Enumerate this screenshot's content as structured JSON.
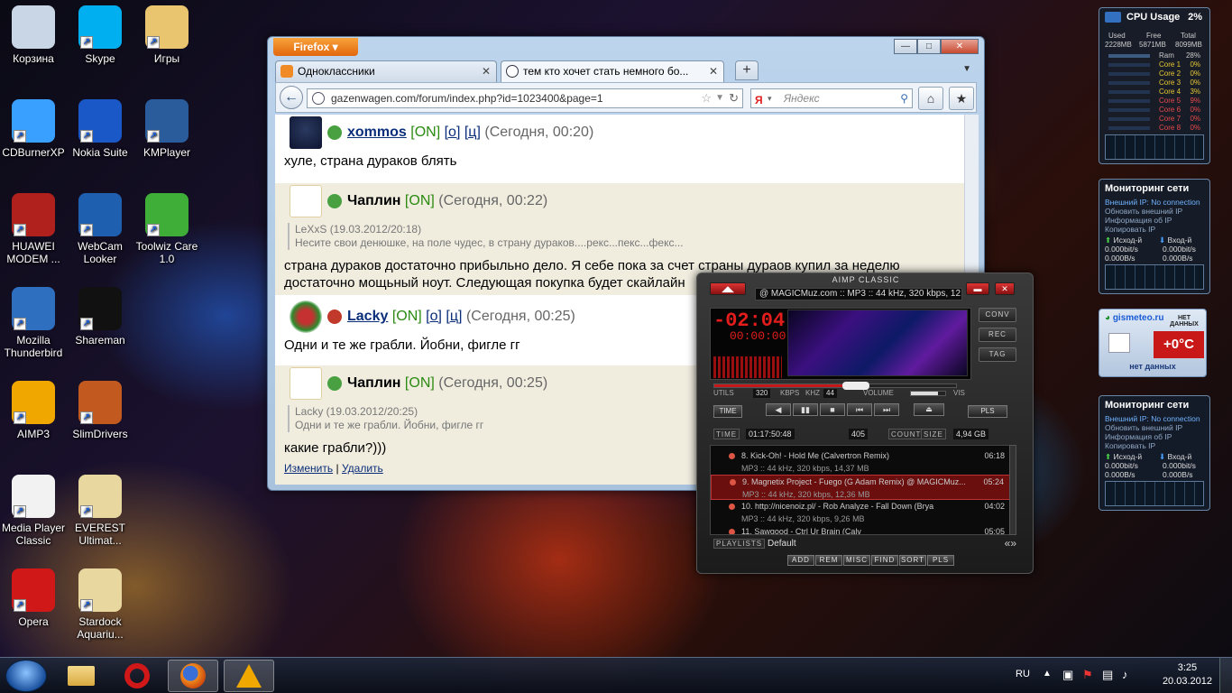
{
  "desktop": {
    "icons": [
      {
        "label": "Корзина",
        "icon": "recycle-bin-icon",
        "color": "#c9d6e6"
      },
      {
        "label": "Skype",
        "icon": "skype-icon",
        "color": "#00aff0"
      },
      {
        "label": "Игры",
        "icon": "folder-icon",
        "color": "#e8c56e"
      },
      {
        "label": "CDBurnerXP",
        "icon": "cd-icon",
        "color": "#3aa0ff"
      },
      {
        "label": "Nokia Suite",
        "icon": "nokia-suite-icon",
        "color": "#1a58c8"
      },
      {
        "label": "KMPlayer",
        "icon": "kmplayer-icon",
        "color": "#2a5c9c"
      },
      {
        "label": "HUAWEI MODEM ...",
        "icon": "helmet-icon",
        "color": "#b0201c"
      },
      {
        "label": "WebCam Looker",
        "icon": "webcam-icon",
        "color": "#1f5fb0"
      },
      {
        "label": "Toolwiz Care 1.0",
        "icon": "shield-icon",
        "color": "#3fae38"
      },
      {
        "label": "Mozilla Thunderbird",
        "icon": "thunderbird-icon",
        "color": "#2e6fc0"
      },
      {
        "label": "Shareman",
        "icon": "shareman-icon",
        "color": "#111111"
      },
      {
        "label": "AIMP3",
        "icon": "aimp-icon",
        "color": "#f0a800"
      },
      {
        "label": "SlimDrivers",
        "icon": "slimdrivers-icon",
        "color": "#c25a20"
      },
      {
        "label": "Media Player Classic",
        "icon": "clapperboard-icon",
        "color": "#f2f2f2"
      },
      {
        "label": "EVEREST Ultimat...",
        "icon": "folder-icon",
        "color": "#e8d8a0"
      },
      {
        "label": "Opera",
        "icon": "opera-icon",
        "color": "#d01818"
      },
      {
        "label": "Stardock Aquariu...",
        "icon": "folder-icon",
        "color": "#e8d8a0"
      }
    ]
  },
  "firefox": {
    "menu_label": "Firefox",
    "tabs": [
      {
        "label": "Одноклассники",
        "color": "#f08a24"
      },
      {
        "label": "тем кто хочет стать немного бо...",
        "color": "#ffffff"
      }
    ],
    "url": "gazenwagen.com/forum/index.php?id=1023400&page=1",
    "search_placeholder": "Яндекс",
    "search_logo": "Я"
  },
  "forum": {
    "posts": [
      {
        "user": "xommos",
        "status": "[ON]",
        "links": [
          "[о]",
          "[ц]"
        ],
        "time": "(Сегодня, 00:20)",
        "body": "хуле, страна дураков блять",
        "quote_head": "",
        "quote_text": ""
      },
      {
        "user": "Чаплин",
        "status": "[ON]",
        "links": [],
        "time": "(Сегодня, 00:22)",
        "quote_head": "LeXxS (19.03.2012/20:18)",
        "quote_text": "Несите свои денюшке, на поле чудес, в страну дураков....рекс...пекс...фекс...",
        "body": "страна дураков достаточно прибыльно дело. Я себе пока за счет страны дураов купил за неделю достаточно мощьный ноут. Следующая покупка будет скайлайн"
      },
      {
        "user": "Lacky",
        "status": "[ON]",
        "links": [
          "[о]",
          "[ц]"
        ],
        "time": "(Сегодня, 00:25)",
        "body": "Одни и те же грабли. Йобни, фигле гг",
        "quote_head": "",
        "quote_text": ""
      },
      {
        "user": "Чаплин",
        "status": "[ON]",
        "links": [],
        "time": "(Сегодня, 00:25)",
        "quote_head": "Lacky (19.03.2012/20:25)",
        "quote_text": "Одни и те же грабли. Йобни, фигле гг",
        "body": "какие грабли?)))"
      }
    ],
    "edit_label": "Изменить",
    "separator": "|",
    "delete_label": "Удалить"
  },
  "aimp": {
    "title": "AIMP CLASSIC",
    "marquee": "@ MAGICMuz.com :: MP3 :: 44 kHz, 320 kbps, 12.",
    "time_main": "-02:04",
    "time_sub": "00:00:00",
    "side_buttons": [
      "CONV",
      "REC",
      "TAG"
    ],
    "utils_label": "UTILS",
    "bitrate": "320",
    "kbps_label": "KBPS",
    "khz_label": "KHZ",
    "khz": "44",
    "volume_label": "VOLUME",
    "vis_label": "VIS",
    "time_btn": "TIME",
    "pls_btn": "PLS",
    "controls": [
      "◀",
      "▮▮",
      "■",
      "⏮",
      "⏭"
    ],
    "eject": "⏏",
    "progress": 0.63,
    "volume": 0.8,
    "time_label": "TIME",
    "total_time": "01:17:50:48",
    "count": "405",
    "count_label": "COUNT",
    "size_label": "SIZE",
    "size": "4,94 GB",
    "playlist": [
      {
        "title": "8. Kick-Oh! - Hold Me (Calvertron Remix)",
        "info": "MP3 :: 44 kHz, 320 kbps, 14,37 MB",
        "duration": "06:18"
      },
      {
        "title": "9. Magnetix Project - Fuego (G Adam Remix) @ MAGICMuz...",
        "info": "MP3 :: 44 kHz, 320 kbps, 12,36 MB",
        "duration": "05:24"
      },
      {
        "title": "10. http://nicenoіz.pl/ - Rob Analyze - Fall Down (Brya",
        "info": "MP3 :: 44 kHz, 320 kbps, 9,26 MB",
        "duration": "04:02"
      },
      {
        "title": "11. Sawgood - Ctrl Ur Brain (Calv",
        "info": "",
        "duration": "05:05"
      }
    ],
    "playlists_label": "PLAYLISTS",
    "playlist_name": "Default",
    "playlist_buttons": [
      "ADD",
      "REM",
      "MISC",
      "FIND",
      "SORT",
      "PLS"
    ]
  },
  "gadgets": {
    "cpu": {
      "title": "CPU Usage",
      "value": "2%",
      "used_label": "Used",
      "free_label": "Free",
      "total_label": "Total",
      "used": "2228MB",
      "free": "5871MB",
      "total": "8099MB",
      "ram_label": "Ram",
      "ram": "28%",
      "cores": [
        {
          "name": "Core 1",
          "value": "0%"
        },
        {
          "name": "Core 2",
          "value": "0%"
        },
        {
          "name": "Core 3",
          "value": "0%"
        },
        {
          "name": "Core 4",
          "value": "3%"
        },
        {
          "name": "Core 5",
          "value": "9%"
        },
        {
          "name": "Core 6",
          "value": "0%"
        },
        {
          "name": "Core 7",
          "value": "0%"
        },
        {
          "name": "Core 8",
          "value": "0%"
        }
      ]
    },
    "net1": {
      "title": "Мониторинг сети",
      "ip_line": "Внешний IP: No connection",
      "refresh": "Обновить внешний IP",
      "info": "Информация об IP",
      "copy": "Копировать IP",
      "out_label": "Исход-й",
      "in_label": "Вход-й",
      "out_bits": "0.000bit/s",
      "in_bits": "0.000bit/s",
      "out_bytes": "0.000B/s",
      "in_bytes": "0.000B/s"
    },
    "weather": {
      "site": "gismeteo.ru",
      "nodata_top": "НЕТ ДАННЫХ",
      "temp": "+0°C",
      "nodata": "нет данных"
    },
    "net2": {
      "title": "Мониторинг сети",
      "ip_line": "Внешний IP: No connection",
      "refresh": "Обновить внешний IP",
      "info": "Информация об IP",
      "copy": "Копировать IP",
      "out_label": "Исход-й",
      "in_label": "Вход-й",
      "out_bits": "0.000bit/s",
      "in_bits": "0.000bit/s",
      "out_bytes": "0.000B/s",
      "in_bytes": "0.000B/s"
    }
  },
  "taskbar": {
    "items": [
      {
        "icon": "explorer-folder-icon"
      },
      {
        "icon": "opera-icon"
      },
      {
        "icon": "firefox-icon"
      },
      {
        "icon": "aimp-icon"
      }
    ],
    "lang": "RU",
    "time": "3:25",
    "date": "20.03.2012"
  }
}
